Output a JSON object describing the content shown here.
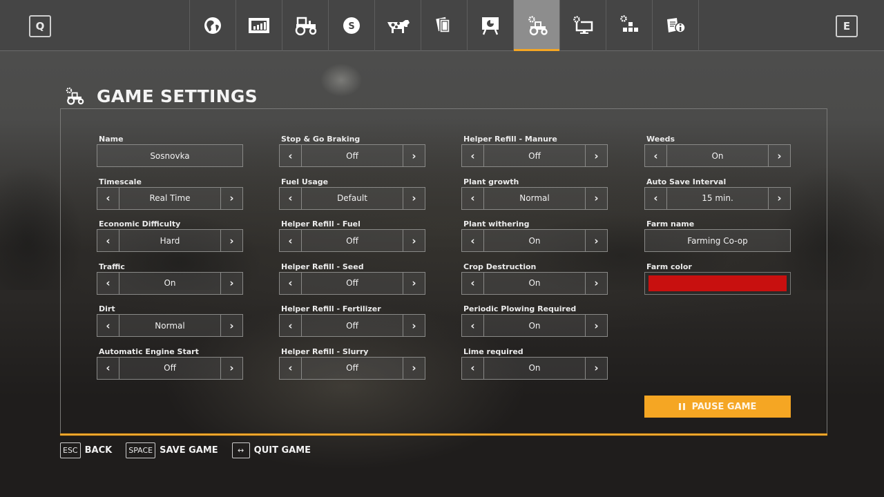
{
  "topbar": {
    "prev_key": "Q",
    "next_key": "E",
    "tabs": [
      {
        "icon": "globe-icon",
        "label": "Map",
        "active": false
      },
      {
        "icon": "chart-icon",
        "label": "Prices",
        "active": false
      },
      {
        "icon": "tractor-icon",
        "label": "Vehicles",
        "active": false
      },
      {
        "icon": "dollar-coin-icon",
        "label": "Finances",
        "active": false
      },
      {
        "icon": "cow-icon",
        "label": "Animals",
        "active": false
      },
      {
        "icon": "contracts-icon",
        "label": "Contracts",
        "active": false
      },
      {
        "icon": "presentation-board-icon",
        "label": "Statistics",
        "active": false
      },
      {
        "icon": "gear-tractor-icon",
        "label": "Game Settings",
        "active": true
      },
      {
        "icon": "gear-monitor-icon",
        "label": "General Settings",
        "active": false
      },
      {
        "icon": "gear-blocks-icon",
        "label": "Controls",
        "active": false
      },
      {
        "icon": "document-info-icon",
        "label": "Help",
        "active": false
      }
    ]
  },
  "header": {
    "icon": "gear-tractor-icon",
    "title": "GAME SETTINGS"
  },
  "columns": [
    {
      "settings": [
        {
          "label": "Name",
          "type": "text",
          "value": "Sosnovka"
        },
        {
          "label": "Timescale",
          "type": "stepper",
          "value": "Real Time"
        },
        {
          "label": "Economic Difficulty",
          "type": "stepper",
          "value": "Hard"
        },
        {
          "label": "Traffic",
          "type": "stepper",
          "value": "On"
        },
        {
          "label": "Dirt",
          "type": "stepper",
          "value": "Normal"
        },
        {
          "label": "Automatic Engine Start",
          "type": "stepper",
          "value": "Off"
        }
      ]
    },
    {
      "settings": [
        {
          "label": "Stop & Go Braking",
          "type": "stepper",
          "value": "Off"
        },
        {
          "label": "Fuel Usage",
          "type": "stepper",
          "value": "Default"
        },
        {
          "label": "Helper Refill - Fuel",
          "type": "stepper",
          "value": "Off"
        },
        {
          "label": "Helper Refill - Seed",
          "type": "stepper",
          "value": "Off"
        },
        {
          "label": "Helper Refill - Fertilizer",
          "type": "stepper",
          "value": "Off"
        },
        {
          "label": "Helper Refill - Slurry",
          "type": "stepper",
          "value": "Off"
        }
      ]
    },
    {
      "settings": [
        {
          "label": "Helper Refill - Manure",
          "type": "stepper",
          "value": "Off"
        },
        {
          "label": "Plant growth",
          "type": "stepper",
          "value": "Normal"
        },
        {
          "label": "Plant withering",
          "type": "stepper",
          "value": "On"
        },
        {
          "label": "Crop Destruction",
          "type": "stepper",
          "value": "On"
        },
        {
          "label": "Periodic Plowing Required",
          "type": "stepper",
          "value": "On"
        },
        {
          "label": "Lime required",
          "type": "stepper",
          "value": "On"
        }
      ]
    },
    {
      "settings": [
        {
          "label": "Weeds",
          "type": "stepper",
          "value": "On"
        },
        {
          "label": "Auto Save Interval",
          "type": "stepper",
          "value": "15 min."
        },
        {
          "label": "Farm name",
          "type": "text",
          "value": "Farming Co-op"
        },
        {
          "label": "Farm color",
          "type": "color",
          "value": "#c8100f"
        }
      ]
    }
  ],
  "stepper_arrows": {
    "left": "‹",
    "right": "›"
  },
  "pause_button": {
    "label": "PAUSE GAME",
    "icon": "pause-icon"
  },
  "footer": [
    {
      "key": "ESC",
      "label": "BACK"
    },
    {
      "key": "SPACE",
      "label": "SAVE GAME"
    },
    {
      "key": "↔",
      "label": "QUIT GAME"
    }
  ],
  "colors": {
    "accent": "#f5a623",
    "active_tab": "#8d8d8d",
    "topbar": "#454545",
    "farm_color": "#c8100f"
  }
}
